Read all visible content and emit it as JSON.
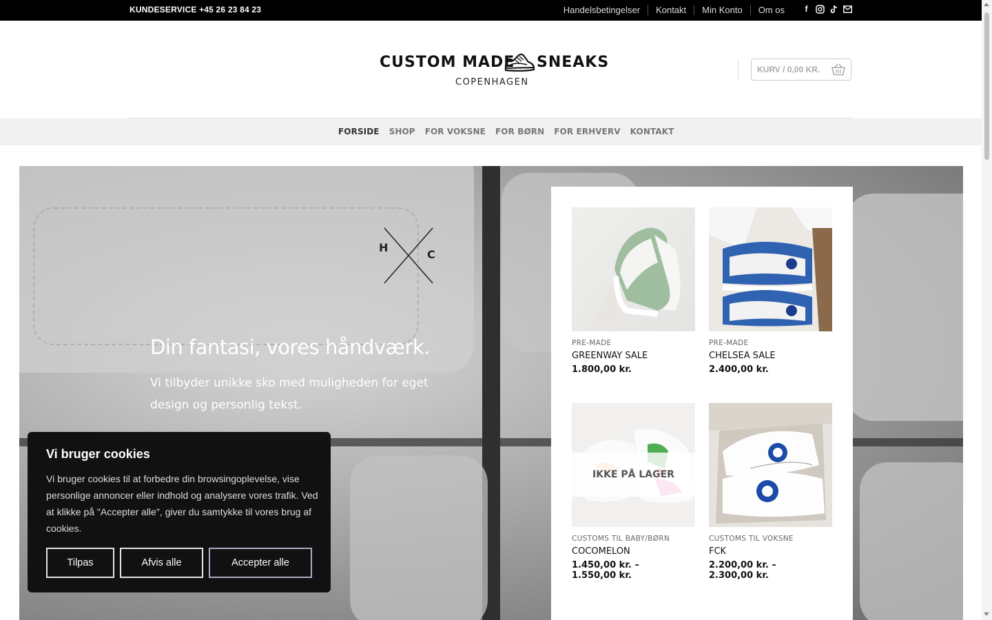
{
  "topbar": {
    "phone": "KUNDESERVICE +45 26 23 84 23",
    "links": [
      "Handelsbetingelser",
      "Kontakt",
      "Min Konto",
      "Om os"
    ],
    "socials": [
      "facebook-icon",
      "instagram-icon",
      "tiktok-icon",
      "email-icon"
    ]
  },
  "logo": {
    "line1a": "CUSTOM MADE",
    "line1b": "SNEAKS",
    "line2": "COPENHAGEN"
  },
  "cart": {
    "label": "KURV / 0,00 KR."
  },
  "nav": [
    "FORSIDE",
    "SHOP",
    "FOR VOKSNE",
    "FOR BØRN",
    "FOR ERHVERV",
    "KONTAKT"
  ],
  "nav_active": "FORSIDE",
  "hero": {
    "title": "Din fantasi, vores håndværk.",
    "subtitle": "Vi tilbyder unikke sko med muligheden for eget design og personlig tekst."
  },
  "products": [
    {
      "category": "PRE-MADE",
      "name": "GREENWAY SALE",
      "price": "1.800,00 kr.",
      "out_of_stock": false
    },
    {
      "category": "PRE-MADE",
      "name": "CHELSEA SALE",
      "price": "2.400,00 kr.",
      "out_of_stock": false
    },
    {
      "category": "CUSTOMS TIL BABY/BØRN",
      "name": "COCOMELON",
      "price": "1.450,00 kr. –",
      "price2": "1.550,00 kr.",
      "out_of_stock": true,
      "badge": "IKKE PÅ LAGER"
    },
    {
      "category": "CUSTOMS TIL VOKSNE",
      "name": "FCK",
      "price": "2.200,00 kr. –",
      "price2": "2.300,00 kr.",
      "out_of_stock": false
    }
  ],
  "cookie": {
    "title": "Vi bruger cookies",
    "text": "Vi bruger cookies til at forbedre din browsingoplevelse, vise personlige annoncer eller indhold og analysere vores trafik. Ved at klikke på \"Accepter alle\", giver du samtykke til vores brug af cookies.",
    "btn_customize": "Tilpas",
    "btn_reject": "Afvis alle",
    "btn_accept": "Accepter alle"
  }
}
